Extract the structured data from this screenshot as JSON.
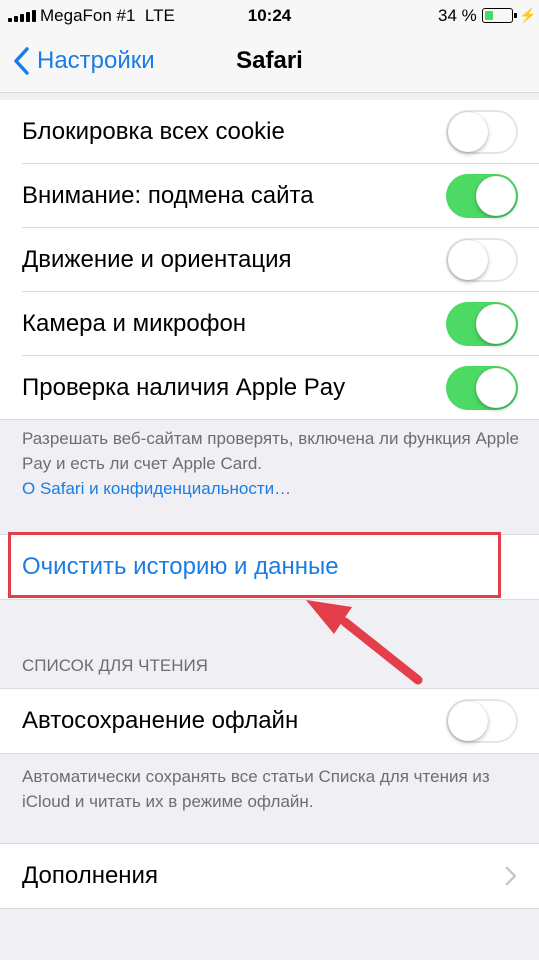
{
  "status_bar": {
    "carrier": "MegaFon #1",
    "network": "LTE",
    "time": "10:24",
    "battery_percent": "34 %",
    "battery_level": 0.34,
    "signal_bars": 5
  },
  "nav": {
    "back_label": "Настройки",
    "title": "Safari"
  },
  "privacy_group": {
    "items": [
      {
        "label": "Блокировка всех cookie",
        "on": false
      },
      {
        "label": "Внимание: подмена сайта",
        "on": true
      },
      {
        "label": "Движение и ориентация",
        "on": false
      },
      {
        "label": "Камера и микрофон",
        "on": true
      },
      {
        "label": "Проверка наличия Apple Pay",
        "on": true
      }
    ],
    "footer_text": "Разрешать веб-сайтам проверять, включена ли функция Apple Pay и есть ли счет Apple Card.",
    "footer_link": "О Safari и конфиденциальности…"
  },
  "clear_history": {
    "label": "Очистить историю и данные"
  },
  "reading_list": {
    "header": "СПИСОК ДЛЯ ЧТЕНИЯ",
    "items": [
      {
        "label": "Автосохранение офлайн",
        "on": false
      }
    ],
    "footer_text": "Автоматически сохранять все статьи Списка для чтения из iCloud и читать их в режиме офлайн."
  },
  "advanced": {
    "label": "Дополнения"
  },
  "colors": {
    "accent": "#1a7de6",
    "toggle_on": "#4cd964",
    "highlight": "#e33e4a"
  }
}
